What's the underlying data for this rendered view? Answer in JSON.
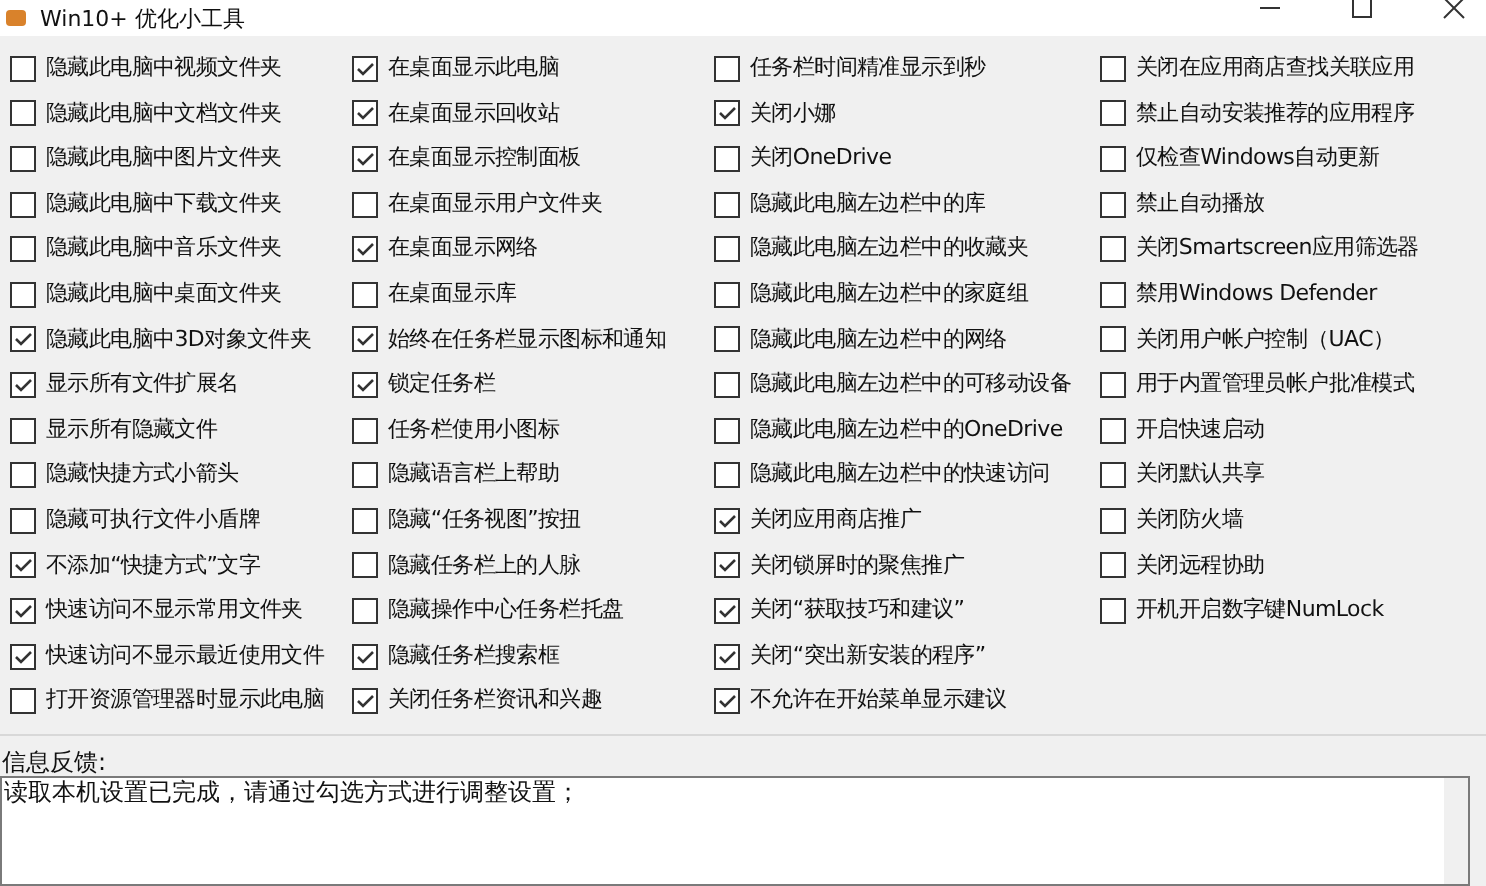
{
  "window": {
    "title": "Win10+ 优化小工具"
  },
  "columns": [
    [
      {
        "label": "隐藏此电脑中视频文件夹",
        "checked": false
      },
      {
        "label": "隐藏此电脑中文档文件夹",
        "checked": false
      },
      {
        "label": "隐藏此电脑中图片文件夹",
        "checked": false
      },
      {
        "label": "隐藏此电脑中下载文件夹",
        "checked": false
      },
      {
        "label": "隐藏此电脑中音乐文件夹",
        "checked": false
      },
      {
        "label": "隐藏此电脑中桌面文件夹",
        "checked": false
      },
      {
        "label": "隐藏此电脑中3D对象文件夹",
        "checked": true
      },
      {
        "label": "显示所有文件扩展名",
        "checked": true
      },
      {
        "label": "显示所有隐藏文件",
        "checked": false
      },
      {
        "label": "隐藏快捷方式小箭头",
        "checked": false
      },
      {
        "label": "隐藏可执行文件小盾牌",
        "checked": false
      },
      {
        "label": "不添加“快捷方式”文字",
        "checked": true
      },
      {
        "label": "快速访问不显示常用文件夹",
        "checked": true
      },
      {
        "label": "快速访问不显示最近使用文件",
        "checked": true
      },
      {
        "label": "打开资源管理器时显示此电脑",
        "checked": false
      }
    ],
    [
      {
        "label": "在桌面显示此电脑",
        "checked": true
      },
      {
        "label": "在桌面显示回收站",
        "checked": true
      },
      {
        "label": "在桌面显示控制面板",
        "checked": true
      },
      {
        "label": "在桌面显示用户文件夹",
        "checked": false
      },
      {
        "label": "在桌面显示网络",
        "checked": true
      },
      {
        "label": "在桌面显示库",
        "checked": false
      },
      {
        "label": "始终在任务栏显示图标和通知",
        "checked": true
      },
      {
        "label": "锁定任务栏",
        "checked": true
      },
      {
        "label": "任务栏使用小图标",
        "checked": false
      },
      {
        "label": "隐藏语言栏上帮助",
        "checked": false
      },
      {
        "label": "隐藏“任务视图”按扭",
        "checked": false
      },
      {
        "label": "隐藏任务栏上的人脉",
        "checked": false
      },
      {
        "label": "隐藏操作中心任务栏托盘",
        "checked": false
      },
      {
        "label": "隐藏任务栏搜索框",
        "checked": true
      },
      {
        "label": "关闭任务栏资讯和兴趣",
        "checked": true
      }
    ],
    [
      {
        "label": "任务栏时间精准显示到秒",
        "checked": false
      },
      {
        "label": "关闭小娜",
        "checked": true
      },
      {
        "label": "关闭OneDrive",
        "checked": false
      },
      {
        "label": "隐藏此电脑左边栏中的库",
        "checked": false
      },
      {
        "label": "隐藏此电脑左边栏中的收藏夹",
        "checked": false
      },
      {
        "label": "隐藏此电脑左边栏中的家庭组",
        "checked": false
      },
      {
        "label": "隐藏此电脑左边栏中的网络",
        "checked": false
      },
      {
        "label": "隐藏此电脑左边栏中的可移动设备",
        "checked": false
      },
      {
        "label": "隐藏此电脑左边栏中的OneDrive",
        "checked": false
      },
      {
        "label": "隐藏此电脑左边栏中的快速访问",
        "checked": false
      },
      {
        "label": "关闭应用商店推广",
        "checked": true
      },
      {
        "label": "关闭锁屏时的聚焦推广",
        "checked": true
      },
      {
        "label": "关闭“获取技巧和建议”",
        "checked": true
      },
      {
        "label": "关闭“突出新安装的程序”",
        "checked": true
      },
      {
        "label": "不允许在开始菜单显示建议",
        "checked": true
      }
    ],
    [
      {
        "label": "关闭在应用商店查找关联应用",
        "checked": false
      },
      {
        "label": "禁止自动安装推荐的应用程序",
        "checked": false
      },
      {
        "label": "仅检查Windows自动更新",
        "checked": false
      },
      {
        "label": "禁止自动播放",
        "checked": false
      },
      {
        "label": "关闭Smartscreen应用筛选器",
        "checked": false
      },
      {
        "label": "禁用Windows Defender",
        "checked": false
      },
      {
        "label": "关闭用户帐户控制（UAC）",
        "checked": false
      },
      {
        "label": "用于内置管理员帐户批准模式",
        "checked": false
      },
      {
        "label": "开启快速启动",
        "checked": false
      },
      {
        "label": "关闭默认共享",
        "checked": false
      },
      {
        "label": "关闭防火墙",
        "checked": false
      },
      {
        "label": "关闭远程协助",
        "checked": false
      },
      {
        "label": "开机开启数字键NumLock",
        "checked": false
      }
    ]
  ],
  "feedback": {
    "label": "信息反馈:",
    "text": "读取本机设置已完成，请通过勾选方式进行调整设置；"
  }
}
